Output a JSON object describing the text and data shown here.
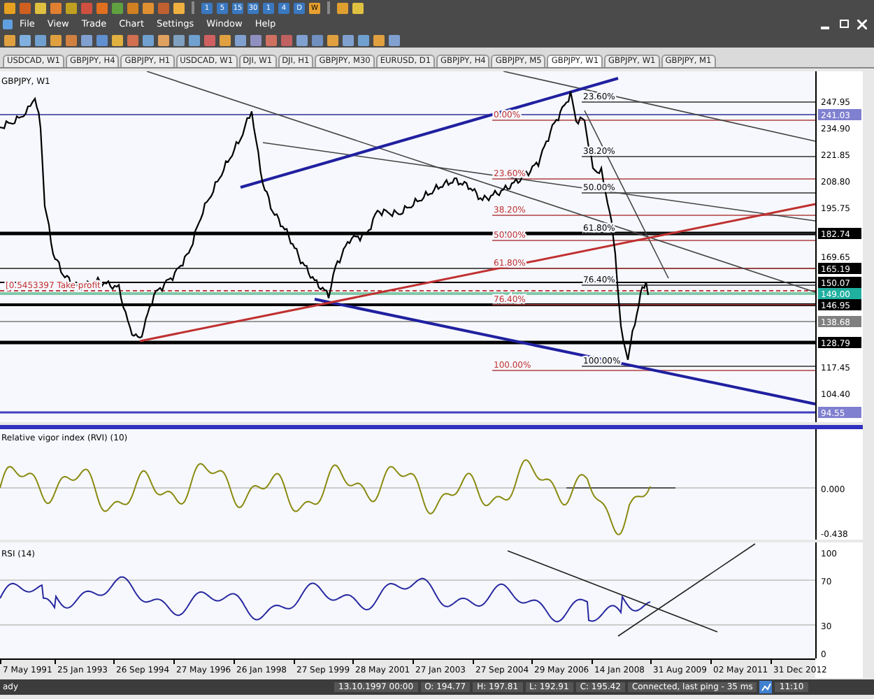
{
  "menu": [
    {
      "label": "File"
    },
    {
      "label": "View"
    },
    {
      "label": "Trade"
    },
    {
      "label": "Chart"
    },
    {
      "label": "Settings"
    },
    {
      "label": "Window"
    },
    {
      "label": "Help"
    }
  ],
  "timeframes": [
    {
      "label": "1",
      "selected": false
    },
    {
      "label": "5",
      "selected": false
    },
    {
      "label": "15",
      "selected": false
    },
    {
      "label": "30",
      "selected": false
    },
    {
      "label": "1",
      "selected": false
    },
    {
      "label": "4",
      "selected": false
    },
    {
      "label": "D",
      "selected": false
    },
    {
      "label": "W",
      "selected": true
    }
  ],
  "tabs": [
    {
      "label": "USDCAD, W1",
      "selected": false
    },
    {
      "label": "GBPJPY, H4",
      "selected": false
    },
    {
      "label": "GBPJPY, H1",
      "selected": false
    },
    {
      "label": "USDCAD, W1",
      "selected": false
    },
    {
      "label": "DJI, W1",
      "selected": false
    },
    {
      "label": "DJI, H1",
      "selected": false
    },
    {
      "label": "GBPJPY, M30",
      "selected": false
    },
    {
      "label": "EURUSD, D1",
      "selected": false
    },
    {
      "label": "GBPJPY, H4",
      "selected": false
    },
    {
      "label": "GBPJPY, M5",
      "selected": false
    },
    {
      "label": "GBPJPY, W1",
      "selected": true
    },
    {
      "label": "GBPJPY, W1",
      "selected": false
    },
    {
      "label": "GBPJPY, M1",
      "selected": false
    }
  ],
  "chart": {
    "title": "GBPJPY, W1",
    "order_label": "[0.5453397 Take profit",
    "price_axis": [
      "247.95",
      "234.90",
      "221.85",
      "208.80",
      "195.75",
      "169.65",
      "117.45",
      "104.40"
    ],
    "price_badges": [
      {
        "text": "241.03",
        "color": "#8080d0"
      },
      {
        "text": "182.74",
        "color": "#000000"
      },
      {
        "text": "165.19",
        "color": "#000000"
      },
      {
        "text": "150.07",
        "color": "#000000"
      },
      {
        "text": "149.00",
        "color": "#20b0a0"
      },
      {
        "text": "146.95",
        "color": "#000000"
      },
      {
        "text": "138.68",
        "color": "#808080"
      },
      {
        "text": "128.79",
        "color": "#000000"
      },
      {
        "text": "94.55",
        "color": "#8080d0"
      }
    ],
    "fib_a": [
      "0.00%",
      "23.60%",
      "38.20%",
      "50.00%",
      "61.80%",
      "76.40%",
      "100.00%"
    ],
    "fib_b": [
      "23.60%",
      "38.20%",
      "50.00%",
      "61.80%",
      "76.40%",
      "100.00%"
    ]
  },
  "rvi": {
    "title": "Relative vigor index (RVI) (10)",
    "axis": [
      "0.000",
      "-0.438"
    ]
  },
  "rsi": {
    "title": "RSI (14)",
    "axis": [
      "100",
      "70",
      "30",
      "0"
    ]
  },
  "dates": [
    "7 May 1991",
    "25 Jan 1993",
    "26 Sep 1994",
    "27 May 1996",
    "26 Jan 1998",
    "27 Sep 1999",
    "28 May 2001",
    "27 Jan 2003",
    "27 Sep 2004",
    "29 May 2006",
    "14 Jan 2008",
    "31 Aug 2009",
    "02 May 2011",
    "31 Dec 2012"
  ],
  "status_bar": {
    "message": "ady",
    "fields": [
      "13.10.1997 00:00",
      "O: 194.77",
      "H: 197.81",
      "L: 192.91",
      "C: 195.42",
      "Connected, last ping - 35 ms"
    ],
    "clock": "11:10"
  }
}
